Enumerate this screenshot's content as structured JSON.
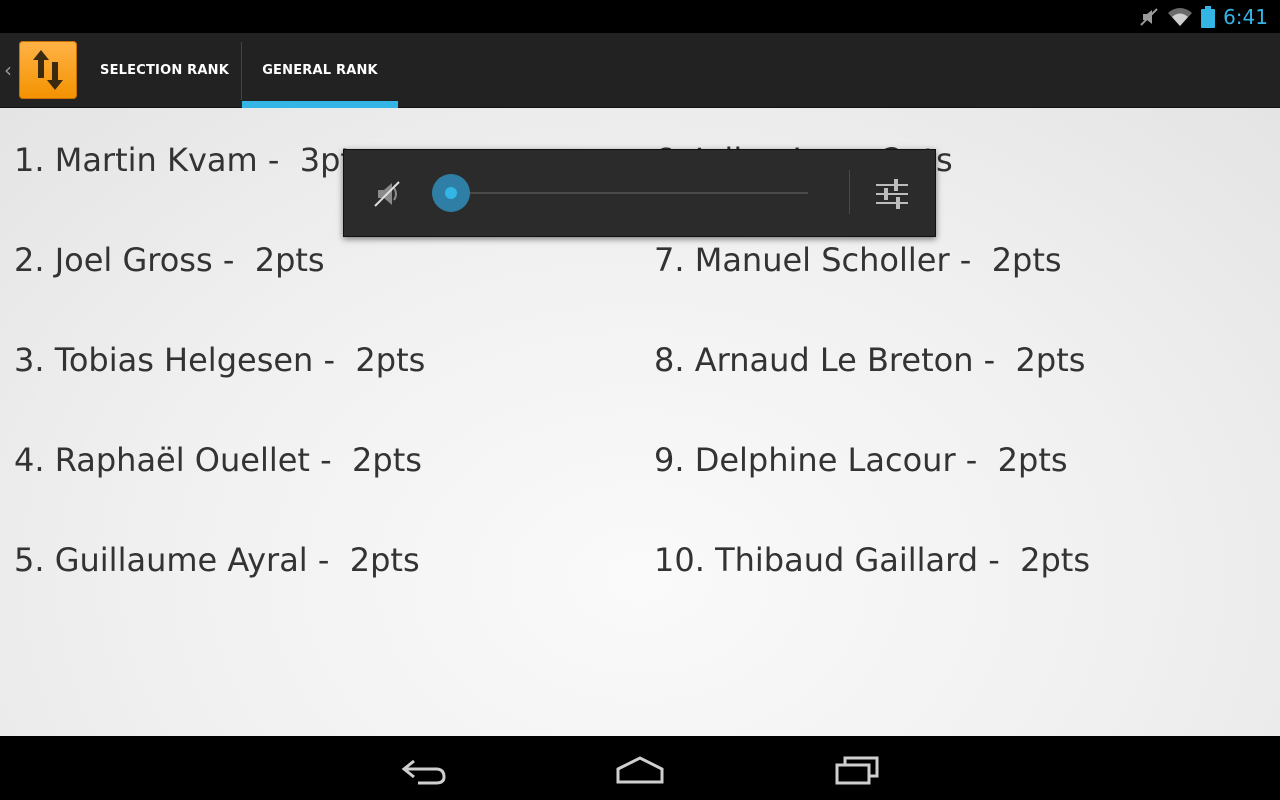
{
  "status_bar": {
    "time": "6:41",
    "icons": [
      "mute-icon",
      "wifi-icon",
      "battery-icon"
    ]
  },
  "action_bar": {
    "app_icon": "sort-arrows-icon",
    "tabs": [
      {
        "label": "SELECTION RANK",
        "selected": false
      },
      {
        "label": "GENERAL RANK",
        "selected": true
      }
    ],
    "accent_color": "#33b5e5"
  },
  "ranking": {
    "left": [
      "1. Martin Kvam -  3pts",
      "2. Joel Gross -  2pts",
      "3. Tobias Helgesen -  2pts",
      "4. Raphaël Ouellet -  2pts",
      "5. Guillaume Ayral -  2pts"
    ],
    "right": [
      "6. Julien L... -  2pts",
      "7. Manuel Scholler -  2pts",
      "8. Arnaud Le Breton -  2pts",
      "9. Delphine Lacour -  2pts",
      "10. Thibaud Gaillard -  2pts"
    ]
  },
  "volume_panel": {
    "icon": "speaker-muted-icon",
    "level": 0.0,
    "settings_icon": "equalizer-settings-icon"
  },
  "nav_bar": {
    "buttons": [
      "back-icon",
      "home-icon",
      "recents-icon"
    ]
  }
}
